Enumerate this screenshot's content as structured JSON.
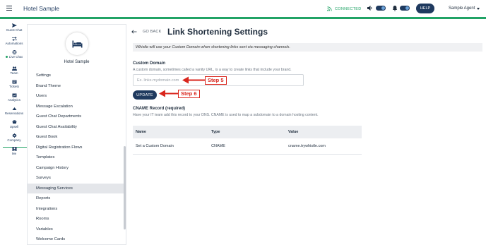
{
  "header": {
    "title": "Hotel Sample",
    "status": "CONNECTED",
    "help_label": "HELP",
    "agent_label": "Sample Agent"
  },
  "rail": [
    {
      "label": "Guest Chat",
      "icon": "send-icon"
    },
    {
      "label": "Automations",
      "icon": "arrows-icon"
    },
    {
      "label": "Live Chat",
      "icon": "globe-icon"
    },
    {
      "label": "Team",
      "icon": "team-icon"
    },
    {
      "label": "Tickets",
      "icon": "ticket-icon"
    },
    {
      "label": "Analytics",
      "icon": "analytics-icon"
    },
    {
      "label": "Reservations",
      "icon": "reservations-icon"
    },
    {
      "label": "Upsell",
      "icon": "upsell-icon"
    },
    {
      "label": "Company",
      "icon": "gear-icon"
    },
    {
      "label": "Me",
      "icon": "person-icon"
    }
  ],
  "menu": {
    "hotel_name": "Hotel Sample",
    "items": [
      "Settings",
      "Brand Theme",
      "Users",
      "Message Escalation",
      "Guest Chat Departments",
      "Guest Chat Availability",
      "Guest Book",
      "Digital Registration Flows",
      "Templates",
      "Campaign History",
      "Surveys",
      "Messaging Services",
      "Reports",
      "Integrations",
      "Rooms",
      "Variables",
      "Welcome Cards"
    ],
    "selected": "Messaging Services"
  },
  "page": {
    "back_label": "GO BACK",
    "title": "Link Shortening Settings",
    "info": "Whistle will use your Custom Domain when shortening links sent via messaging channels.",
    "custom_domain": {
      "label": "Custom Domain",
      "description": "A custom domain, sometimes called a vanity URL, is a way to create links that include your brand.",
      "placeholder": "Ex. links.mydomain.com",
      "value": ""
    },
    "update_label": "UPDATE",
    "step5": "Step 5",
    "step6": "Step 6",
    "cname": {
      "label": "CNAME Record (required)",
      "description": "Have your IT team add this record to your DNS. CNAME is used to map a subdomain to a domain hosting content.",
      "columns": [
        "Name",
        "Type",
        "Value"
      ],
      "rows": [
        [
          "Set a Custom Domain",
          "CNAME",
          "cname.trywhistle.com"
        ]
      ]
    }
  },
  "colors": {
    "brand": "#1f3a5f",
    "accent": "#21a366",
    "annotation": "#d9251c"
  }
}
